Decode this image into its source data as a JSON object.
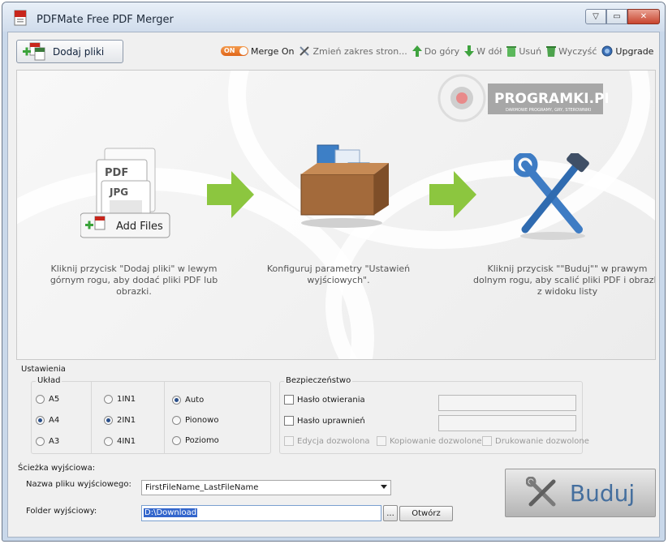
{
  "window": {
    "title": "PDFMate Free PDF Merger",
    "controls": {
      "help": "▽",
      "minimize": "▭",
      "close": "✕"
    }
  },
  "toolbar": {
    "add_files_label": "Dodaj pliki",
    "toggle_text": "ON",
    "merge_label": "Merge On",
    "change_range_label": "Zmień zakres stron...",
    "move_up_label": "Do góry",
    "move_down_label": "W dół",
    "remove_label": "Usuń",
    "clear_label": "Wyczyść",
    "upgrade_label": "Upgrade"
  },
  "steps": {
    "add_files_graphic_label": "Add Files",
    "doc_labels": [
      "PDF",
      "JPG"
    ],
    "watermark_main": "PROGRAMKI.PL",
    "watermark_sub": "DARMOWE PROGRAMY, GRY, STEROWNIKI",
    "step1": "Kliknij przycisk \"Dodaj pliki\" w lewym górnym rogu, aby dodać pliki PDF lub obrazki.",
    "step2": "Konfiguruj parametry \"Ustawień wyjściowych\".",
    "step3": "Kliknij przycisk \"\"Buduj\"\" w prawym dolnym rogu, aby scalić pliki PDF i obrazki z widoku listy"
  },
  "settings": {
    "section_label": "Ustawienia",
    "layout_label": "Układ",
    "paper_sizes": [
      {
        "label": "A5",
        "selected": false
      },
      {
        "label": "A4",
        "selected": true
      },
      {
        "label": "A3",
        "selected": false
      }
    ],
    "pages_per_sheet": [
      {
        "label": "1IN1",
        "selected": false
      },
      {
        "label": "2IN1",
        "selected": true
      },
      {
        "label": "4IN1",
        "selected": false
      }
    ],
    "orientation": [
      {
        "label": "Auto",
        "selected": true
      },
      {
        "label": "Pionowo",
        "selected": false
      },
      {
        "label": "Poziomo",
        "selected": false
      }
    ],
    "security_label": "Bezpieczeństwo",
    "open_password_label": "Hasło otwierania",
    "permissions_password_label": "Hasło uprawnień",
    "open_password_value": "",
    "permissions_password_value": "",
    "allow_edit_label": "Edycja dozwolona",
    "allow_copy_label": "Kopiowanie dozwolone",
    "allow_print_label": "Drukowanie dozwolone"
  },
  "output": {
    "section_label": "Ścieżka wyjściowa:",
    "filename_label": "Nazwa pliku wyjściowego:",
    "filename_value": "FirstFileName_LastFileName",
    "folder_label": "Folder wyjściowy:",
    "folder_value": "D:\\Download",
    "browse_label": "...",
    "open_label": "Otwórz"
  },
  "build": {
    "label": "Buduj"
  },
  "colors": {
    "accent_blue": "#456f9e",
    "arrow_green": "#8cc63f",
    "toggle_orange": "#e0661a"
  }
}
